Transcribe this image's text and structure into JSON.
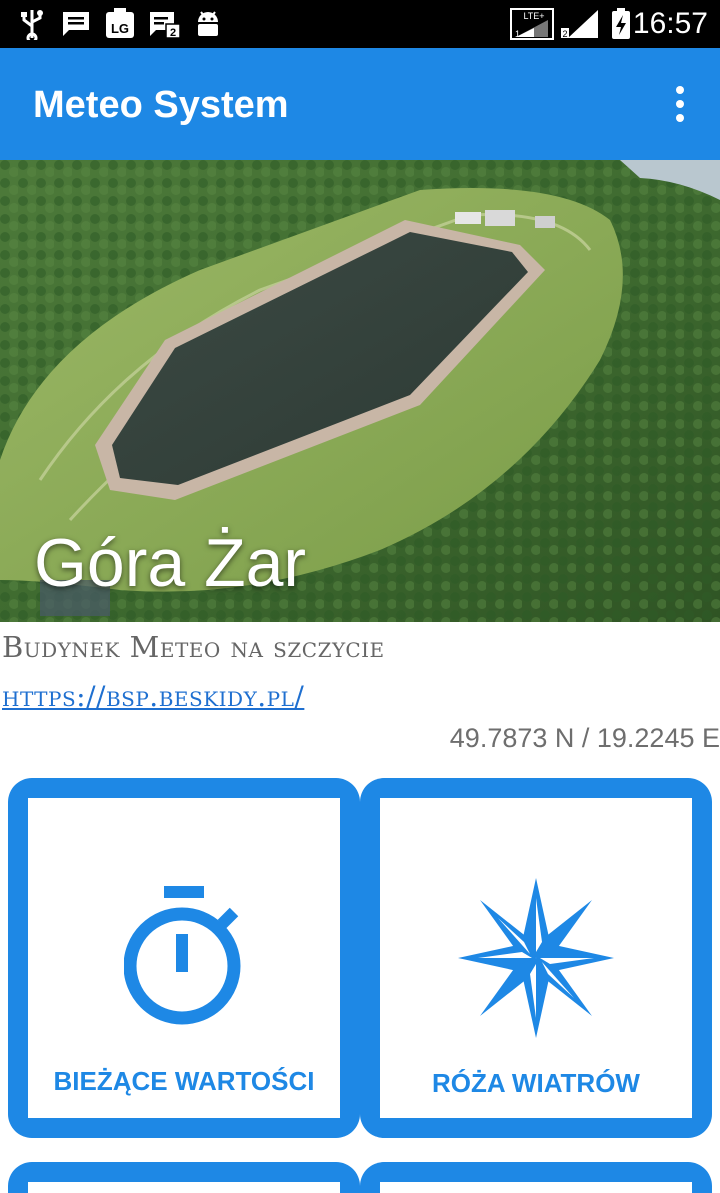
{
  "status_bar": {
    "time": "16:57",
    "icons": [
      "usb-icon",
      "message-icon",
      "lg-icon",
      "sim-message-icon",
      "android-icon",
      "lte-signal-icon",
      "signal-icon",
      "battery-charging-icon"
    ],
    "lte_label": "LTE+"
  },
  "app_bar": {
    "title": "Meteo System",
    "menu_icon": "more-vert-icon"
  },
  "location": {
    "name": "Góra Żar",
    "description": "Budynek Meteo na szczycie",
    "url": "https://bsp.beskidy.pl/",
    "coordinates": "49.7873 N / 19.2245 E"
  },
  "tiles": [
    {
      "label": "BIEŻĄCE WARTOŚCI",
      "icon": "stopwatch-icon"
    },
    {
      "label": "RÓŻA WIATRÓW",
      "icon": "compass-rose-icon"
    }
  ],
  "colors": {
    "primary": "#1e88e5",
    "status_bar": "#000000",
    "text_secondary": "#666666",
    "link": "#1e6fd0"
  }
}
